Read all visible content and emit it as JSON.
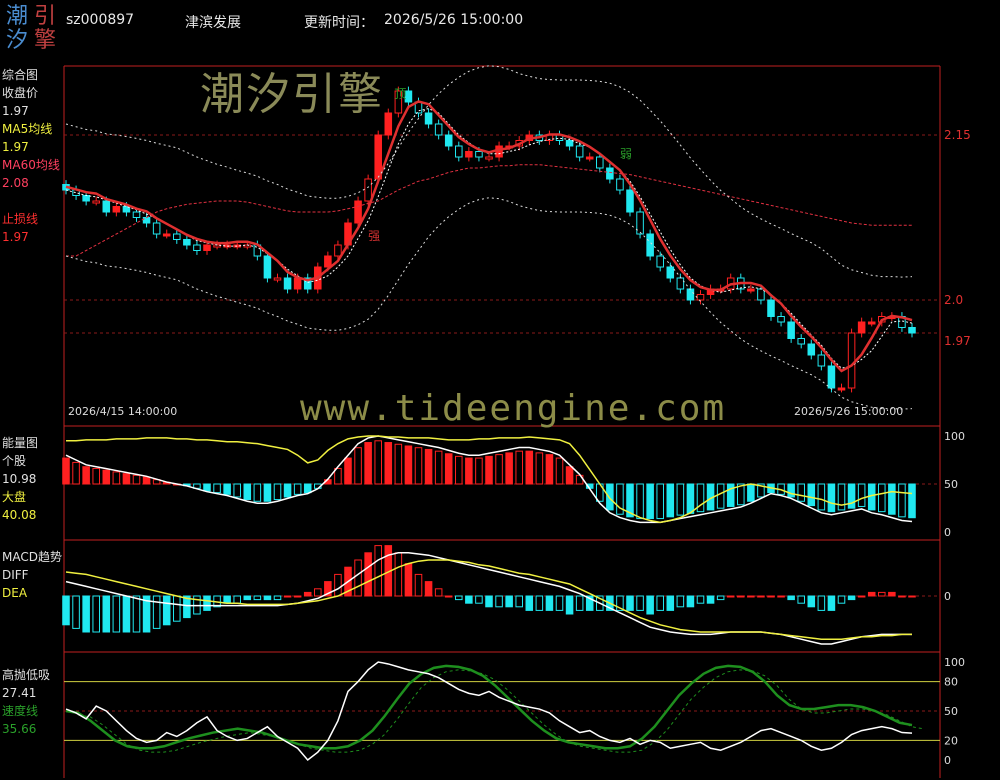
{
  "header": {
    "logo_chars": [
      "潮",
      "引",
      "汐",
      "擎"
    ],
    "code": "sz000897",
    "name": "津滨发展",
    "update_label": "更新时间：",
    "update_time": "2026/5/26 15:00:00"
  },
  "watermark": {
    "cn": "潮汐引擎",
    "url": "www.tideengine.com"
  },
  "colors": {
    "axis": "#c02020",
    "up": "#ff2020",
    "down": "#20e8f0",
    "ma5": "#ffffff",
    "ma60": "#e03040",
    "stop": "#e03030",
    "yellow": "#f0f040",
    "green": "#1e8f1e"
  },
  "main_panel": {
    "labels": [
      {
        "text": "综合图",
        "color": "#e0e0e0"
      },
      {
        "text": "收盘价",
        "color": "#e0e0e0"
      },
      {
        "text": "1.97",
        "color": "#e0e0e0"
      },
      {
        "text": "MA5均线",
        "color": "#f0f040"
      },
      {
        "text": "1.97",
        "color": "#f0f040"
      },
      {
        "text": "MA60均线",
        "color": "#ff4060"
      },
      {
        "text": "2.08",
        "color": "#ff4060"
      },
      {
        "text": "",
        "color": "#e0e0e0"
      },
      {
        "text": "止损线",
        "color": "#ff3030"
      },
      {
        "text": "1.97",
        "color": "#ff3030"
      }
    ],
    "right_ticks": [
      "2.15",
      "2.0",
      "1.97"
    ],
    "date_start": "2026/4/15 14:00:00",
    "date_end": "2026/5/26 15:00:00",
    "markers": {
      "top": "顶",
      "weak": "弱",
      "strong": "强"
    }
  },
  "energy_panel": {
    "labels": [
      {
        "text": "能量图",
        "color": "#e0e0e0"
      },
      {
        "text": "个股",
        "color": "#e0e0e0"
      },
      {
        "text": "10.98",
        "color": "#e0e0e0"
      },
      {
        "text": "大盘",
        "color": "#f0f040"
      },
      {
        "text": "40.08",
        "color": "#f0f040"
      }
    ],
    "right_ticks": [
      "100",
      "50",
      "0"
    ]
  },
  "macd_panel": {
    "labels": [
      {
        "text": "MACD趋势",
        "color": "#e0e0e0"
      },
      {
        "text": "DIFF",
        "color": "#e0e0e0"
      },
      {
        "text": "DEA",
        "color": "#f0f040"
      }
    ],
    "right_ticks": [
      "0"
    ]
  },
  "osc_panel": {
    "labels": [
      {
        "text": "高抛低吸",
        "color": "#e0e0e0"
      },
      {
        "text": "27.41",
        "color": "#e0e0e0"
      },
      {
        "text": "速度线",
        "color": "#2aa02a"
      },
      {
        "text": "35.66",
        "color": "#2aa02a"
      }
    ],
    "right_ticks": [
      "100",
      "80",
      "50",
      "20",
      "0"
    ]
  },
  "chart_data": [
    {
      "type": "candlestick",
      "title": "综合图",
      "ylim": [
        1.9,
        2.2
      ],
      "yticks": [
        2.15,
        2.0
      ],
      "closes": [
        2.1,
        2.095,
        2.09,
        2.09,
        2.08,
        2.085,
        2.08,
        2.075,
        2.07,
        2.06,
        2.06,
        2.055,
        2.05,
        2.045,
        2.05,
        2.05,
        2.05,
        2.05,
        2.05,
        2.04,
        2.02,
        2.02,
        2.01,
        2.02,
        2.01,
        2.03,
        2.04,
        2.05,
        2.07,
        2.09,
        2.11,
        2.15,
        2.17,
        2.19,
        2.18,
        2.17,
        2.16,
        2.15,
        2.14,
        2.13,
        2.135,
        2.13,
        2.13,
        2.14,
        2.14,
        2.145,
        2.15,
        2.145,
        2.15,
        2.145,
        2.14,
        2.13,
        2.13,
        2.12,
        2.11,
        2.1,
        2.08,
        2.06,
        2.04,
        2.03,
        2.02,
        2.01,
        2.0,
        2.005,
        2.01,
        2.01,
        2.02,
        2.01,
        2.01,
        2.0,
        1.985,
        1.98,
        1.965,
        1.96,
        1.95,
        1.94,
        1.92,
        1.92,
        1.97,
        1.98,
        1.98,
        1.985,
        1.985,
        1.975,
        1.97
      ],
      "ma60": [
        2.04,
        2.04,
        2.045,
        2.05,
        2.055,
        2.06,
        2.065,
        2.07,
        2.075,
        2.08,
        2.083,
        2.085,
        2.087,
        2.088,
        2.089,
        2.09,
        2.09,
        2.09,
        2.089,
        2.087,
        2.085,
        2.083,
        2.081,
        2.08,
        2.08,
        2.08,
        2.08,
        2.081,
        2.083,
        2.085,
        2.088,
        2.09,
        2.095,
        2.1,
        2.104,
        2.108,
        2.11,
        2.113,
        2.116,
        2.118,
        2.12,
        2.12,
        2.121,
        2.122,
        2.122,
        2.123,
        2.123,
        2.123,
        2.122,
        2.121,
        2.12,
        2.119,
        2.118,
        2.117,
        2.116,
        2.115,
        2.114,
        2.112,
        2.11,
        2.108,
        2.106,
        2.104,
        2.102,
        2.1,
        2.098,
        2.096,
        2.094,
        2.092,
        2.09,
        2.088,
        2.086,
        2.084,
        2.082,
        2.08,
        2.078,
        2.076,
        2.074,
        2.072,
        2.07,
        2.069,
        2.068,
        2.068,
        2.068,
        2.068,
        2.068
      ]
    },
    {
      "type": "bar",
      "title": "能量图",
      "ylim": [
        0,
        100
      ],
      "yticks": [
        100,
        50,
        0
      ],
      "series": [
        {
          "name": "个股",
          "values": [
            80,
            75,
            70,
            68,
            66,
            64,
            62,
            60,
            58,
            55,
            52,
            50,
            48,
            45,
            42,
            40,
            38,
            35,
            32,
            30,
            30,
            32,
            35,
            38,
            40,
            45,
            55,
            68,
            80,
            92,
            98,
            100,
            98,
            96,
            94,
            92,
            90,
            88,
            85,
            82,
            80,
            80,
            82,
            84,
            86,
            88,
            88,
            86,
            84,
            80,
            70,
            60,
            45,
            30,
            20,
            15,
            12,
            10,
            10,
            10,
            12,
            14,
            16,
            18,
            20,
            22,
            24,
            26,
            30,
            35,
            40,
            38,
            35,
            30,
            25,
            20,
            18,
            20,
            22,
            24,
            20,
            18,
            15,
            12,
            10.98
          ]
        },
        {
          "name": "大盘",
          "values": [
            95,
            95,
            96,
            96,
            96,
            97,
            97,
            97,
            98,
            98,
            98,
            97,
            97,
            96,
            96,
            95,
            94,
            94,
            93,
            92,
            90,
            88,
            86,
            80,
            72,
            75,
            85,
            92,
            97,
            99,
            100,
            100,
            99,
            99,
            98,
            98,
            98,
            97,
            96,
            96,
            96,
            97,
            97,
            98,
            98,
            98,
            99,
            98,
            97,
            96,
            92,
            80,
            65,
            50,
            35,
            25,
            20,
            15,
            12,
            10,
            12,
            15,
            20,
            28,
            35,
            40,
            45,
            48,
            50,
            48,
            46,
            44,
            40,
            38,
            36,
            34,
            30,
            28,
            30,
            35,
            38,
            40,
            42,
            41,
            40.08
          ]
        }
      ]
    },
    {
      "type": "bar",
      "title": "MACD趋势",
      "ylim": [
        -0.04,
        0.04
      ],
      "series": [
        {
          "name": "DIFF",
          "values": [
            0.012,
            0.01,
            0.008,
            0.006,
            0.004,
            0.002,
            0.0,
            -0.002,
            -0.004,
            -0.005,
            -0.006,
            -0.007,
            -0.008,
            -0.008,
            -0.008,
            -0.008,
            -0.008,
            -0.008,
            -0.008,
            -0.008,
            -0.008,
            -0.008,
            -0.007,
            -0.006,
            -0.004,
            -0.002,
            0.002,
            0.006,
            0.012,
            0.018,
            0.024,
            0.03,
            0.034,
            0.036,
            0.036,
            0.035,
            0.034,
            0.032,
            0.03,
            0.028,
            0.026,
            0.024,
            0.022,
            0.02,
            0.018,
            0.016,
            0.014,
            0.012,
            0.01,
            0.008,
            0.005,
            0.002,
            -0.002,
            -0.006,
            -0.01,
            -0.014,
            -0.018,
            -0.022,
            -0.026,
            -0.028,
            -0.03,
            -0.031,
            -0.032,
            -0.032,
            -0.032,
            -0.031,
            -0.03,
            -0.03,
            -0.03,
            -0.03,
            -0.031,
            -0.032,
            -0.034,
            -0.036,
            -0.038,
            -0.04,
            -0.04,
            -0.038,
            -0.036,
            -0.034,
            -0.033,
            -0.032,
            -0.032,
            -0.032,
            -0.032
          ]
        },
        {
          "name": "DEA",
          "values": [
            0.02,
            0.019,
            0.018,
            0.016,
            0.014,
            0.012,
            0.01,
            0.008,
            0.006,
            0.004,
            0.002,
            0.0,
            -0.002,
            -0.003,
            -0.004,
            -0.005,
            -0.006,
            -0.006,
            -0.007,
            -0.007,
            -0.007,
            -0.007,
            -0.007,
            -0.006,
            -0.005,
            -0.004,
            -0.002,
            0.0,
            0.004,
            0.008,
            0.012,
            0.016,
            0.02,
            0.024,
            0.027,
            0.029,
            0.03,
            0.03,
            0.03,
            0.029,
            0.028,
            0.026,
            0.025,
            0.023,
            0.021,
            0.019,
            0.018,
            0.016,
            0.014,
            0.012,
            0.01,
            0.006,
            0.002,
            -0.002,
            -0.006,
            -0.01,
            -0.014,
            -0.018,
            -0.021,
            -0.024,
            -0.026,
            -0.028,
            -0.029,
            -0.03,
            -0.03,
            -0.03,
            -0.03,
            -0.03,
            -0.03,
            -0.03,
            -0.031,
            -0.032,
            -0.033,
            -0.034,
            -0.035,
            -0.036,
            -0.036,
            -0.036,
            -0.035,
            -0.034,
            -0.034,
            -0.033,
            -0.033,
            -0.032,
            -0.032
          ]
        }
      ]
    },
    {
      "type": "line",
      "title": "高抛低吸",
      "ylim": [
        0,
        100
      ],
      "yticks": [
        100,
        80,
        50,
        20,
        0
      ],
      "series": [
        {
          "name": "高抛低吸",
          "values": [
            52,
            48,
            42,
            55,
            50,
            40,
            30,
            22,
            18,
            20,
            28,
            24,
            30,
            38,
            44,
            30,
            24,
            20,
            22,
            28,
            34,
            24,
            18,
            12,
            0,
            8,
            20,
            40,
            70,
            80,
            92,
            100,
            98,
            95,
            92,
            90,
            88,
            84,
            78,
            72,
            68,
            66,
            70,
            64,
            60,
            56,
            54,
            52,
            48,
            40,
            34,
            28,
            30,
            24,
            20,
            18,
            22,
            16,
            20,
            18,
            12,
            14,
            16,
            18,
            12,
            10,
            14,
            18,
            24,
            30,
            32,
            28,
            24,
            20,
            14,
            10,
            12,
            18,
            26,
            30,
            32,
            34,
            32,
            28,
            27.41
          ]
        },
        {
          "name": "速度线",
          "values": [
            50,
            48,
            40,
            30,
            20,
            14,
            12,
            12,
            14,
            18,
            22,
            25,
            28,
            30,
            32,
            30,
            28,
            24,
            20,
            16,
            14,
            12,
            12,
            14,
            20,
            30,
            45,
            62,
            78,
            88,
            94,
            96,
            95,
            92,
            86,
            76,
            64,
            52,
            40,
            30,
            22,
            18,
            16,
            14,
            12,
            12,
            14,
            22,
            34,
            50,
            66,
            78,
            88,
            94,
            96,
            95,
            90,
            80,
            66,
            56,
            52,
            52,
            54,
            56,
            56,
            54,
            50,
            44,
            38,
            35.66
          ]
        }
      ]
    }
  ]
}
